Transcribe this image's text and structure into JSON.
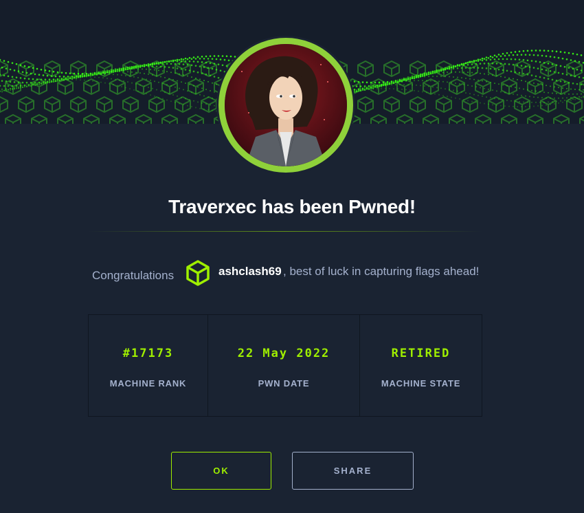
{
  "modal": {
    "title": "Traverxec has been Pwned!",
    "congrats_label": "Congratulations",
    "username": "ashclash69",
    "congrats_suffix": ", best of luck in capturing flags ahead!"
  },
  "stats": [
    {
      "value": "#17173",
      "label": "MACHINE RANK"
    },
    {
      "value": "22 May 2022",
      "label": "PWN DATE"
    },
    {
      "value": "RETIRED",
      "label": "MACHINE STATE"
    }
  ],
  "buttons": {
    "ok_label": "OK",
    "share_label": "SHARE"
  },
  "icons": {
    "user": "cube-icon",
    "banner": "cube-grid-banner",
    "avatar": "machine-avatar"
  },
  "colors": {
    "background": "#1a2332",
    "accent_green": "#9fef00",
    "text_muted": "#a4b1cd",
    "avatar_ring": "#8fd13a"
  }
}
